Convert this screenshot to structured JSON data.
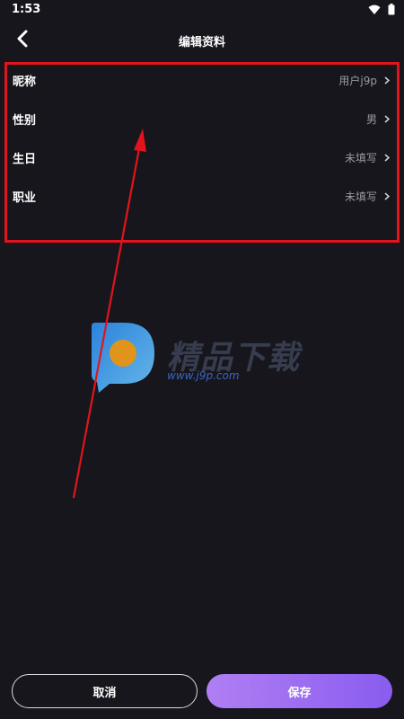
{
  "status_bar": {
    "time": "1:53",
    "icons": [
      "wifi-icon",
      "battery-icon"
    ]
  },
  "app_bar": {
    "title": "编辑资料",
    "back_icon": "chevron-left-icon"
  },
  "profile": {
    "rows": [
      {
        "label": "昵称",
        "value": "用户j9p"
      },
      {
        "label": "性别",
        "value": "男"
      },
      {
        "label": "生日",
        "value": "未填写"
      },
      {
        "label": "职业",
        "value": "未填写"
      }
    ]
  },
  "watermark": {
    "title": "精品下载",
    "url": "www.j9p.com"
  },
  "buttons": {
    "cancel": "取消",
    "save": "保存"
  },
  "colors": {
    "background": "#16161c",
    "accent": "#9b6cf2",
    "annotation": "#e1141d",
    "secondary_text": "#9a9aa3"
  }
}
